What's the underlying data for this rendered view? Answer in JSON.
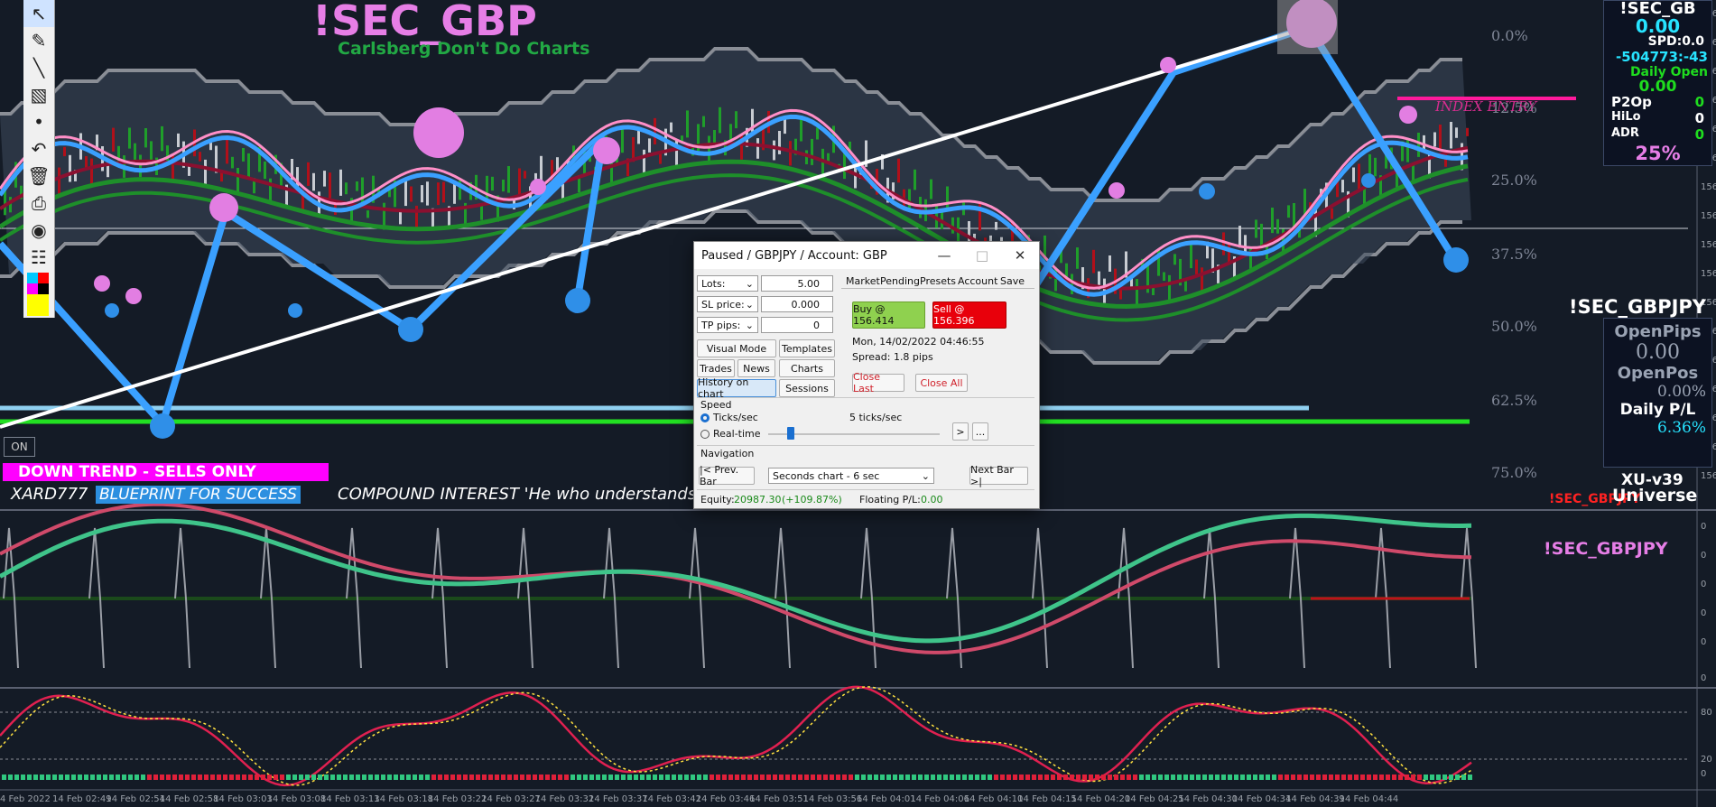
{
  "chart": {
    "symbol_title": "!SEC_GBP",
    "subtitle": "Carlsberg Don't Do Charts",
    "index_entry_label": "INDEX ENTRY",
    "fib_levels": [
      "0.0%",
      "12.5%",
      "25.0%",
      "37.5%",
      "50.0%",
      "62.5%",
      "75.0%"
    ],
    "on_button": "ON",
    "trend_banner": "DOWN TREND - SELLS ONLY",
    "ticker_text_1": "XARD777",
    "ticker_text_2": "BLUEPRINT FOR SUCCESS",
    "ticker_text_3": "COMPOUND INTEREST  'He who understands",
    "osc_symbol": "!SEC_GBPJPY",
    "bottom_symbol_overlay": "!SEC_GBPJPY",
    "osc_levels": [
      "80",
      "20"
    ],
    "time_axis": [
      "4 Feb 2022",
      "14 Feb 02:49",
      "14 Feb 02:54",
      "14 Feb 02:58",
      "14 Feb 03:03",
      "14 Feb 03:08",
      "14 Feb 03:13",
      "14 Feb 03:18",
      "14 Feb 03:22",
      "14 Feb 03:27",
      "14 Feb 03:32",
      "14 Feb 03:37",
      "14 Feb 03:42",
      "14 Feb 03:46",
      "14 Feb 03:51",
      "14 Feb 03:56",
      "14 Feb 04:01",
      "14 Feb 04:06",
      "14 Feb 04:10",
      "14 Feb 04:15",
      "14 Feb 04:20",
      "14 Feb 04:25",
      "14 Feb 04:30",
      "14 Feb 04:34",
      "14 Feb 04:39",
      "14 Feb 04:44"
    ],
    "price_axis": [
      "156",
      "156",
      "156",
      "156",
      "156",
      "156",
      "156",
      "156",
      "156",
      "156",
      "156",
      "156",
      "156",
      "156",
      "156",
      "156",
      "156"
    ],
    "sub_axis_1": [
      "0",
      "0",
      "0",
      "0",
      "0"
    ],
    "sub_axis_2": [
      "0",
      "80",
      "20",
      "0"
    ]
  },
  "right_panel": {
    "sym_head": "!SEC_GB",
    "spd_big": "0.00",
    "spd_label": "SPD:0.0",
    "numbers": "-504773:-43",
    "daily_open_label": "Daily Open",
    "daily_open_value": "0.00",
    "p2op_label": "P2Op",
    "p2op_value": "0",
    "hilo_label": "HiLo",
    "hilo_value": "0",
    "adr_label": "ADR",
    "adr_value": "0",
    "adr_pct": "25%",
    "symbol2": "!SEC_GBPJPY",
    "open_pips_label": "OpenPips",
    "open_pips_value": "0.00",
    "open_pos_label": "OpenPos",
    "open_pos_value": "0.00%",
    "daily_pl_label": "Daily P/L",
    "daily_pl_value": "6.36%",
    "version": "XU-v39",
    "universe": "Universe"
  },
  "dialog": {
    "title": "Paused / GBPJPY / Account: GBP",
    "lots_label": "Lots:",
    "lots_value": "5.00",
    "sl_label": "SL price:",
    "sl_value": "0.000",
    "tp_label": "TP pips:",
    "tp_value": "0",
    "visual_mode": "Visual Mode",
    "templates": "Templates",
    "trades": "Trades",
    "news": "News",
    "charts": "Charts",
    "history_on_chart": "History on chart",
    "sessions": "Sessions",
    "tabs": [
      "Market",
      "Pending",
      "Presets",
      "Account",
      "Save"
    ],
    "buy_label": "Buy @ 156.414",
    "sell_label": "Sell @ 156.396",
    "datetime": "Mon, 14/02/2022  04:46:55",
    "spread": "Spread:  1.8 pips",
    "close_last": "Close Last",
    "close_all": "Close All",
    "speed_label": "Speed",
    "ticks_sec": "Ticks/sec",
    "real_time": "Real-time",
    "speed_value": "5 ticks/sec",
    "play_btn": ">",
    "more_btn": "...",
    "navigation_label": "Navigation",
    "prev_bar": "|< Prev. Bar",
    "chart_select": "Seconds chart - 6 sec",
    "next_bar": "Next Bar >|",
    "equity_label": "Equity:",
    "equity_value": "20987.30",
    "equity_pct": "(+109.87%)",
    "floating_label": "Floating P/L:",
    "floating_value": "0.00"
  },
  "toolbar": {
    "icons": [
      "cursor-icon",
      "pencil-icon",
      "line-icon",
      "eraser-icon",
      "dot-icon",
      "undo-icon",
      "trash-icon",
      "printer-icon",
      "camera-icon",
      "clipboard-icon"
    ]
  }
}
